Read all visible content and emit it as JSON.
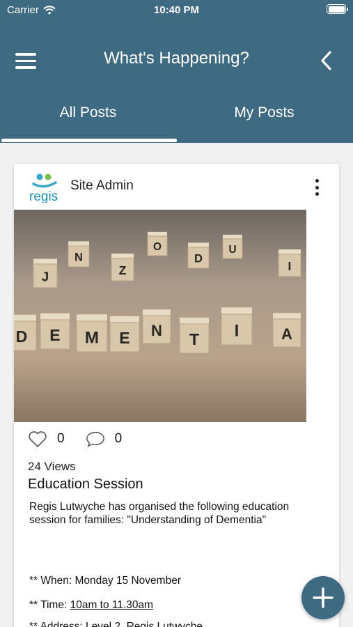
{
  "status_bar": {
    "carrier": "Carrier",
    "time": "10:40 PM"
  },
  "header": {
    "title": "What's Happening?",
    "menu_icon": "hamburger-menu-icon",
    "back_icon": "chevron-left-icon",
    "background": "#3e6a82"
  },
  "tabs": [
    {
      "label": "All Posts",
      "active": true
    },
    {
      "label": "My Posts",
      "active": false
    }
  ],
  "post": {
    "author": "Site Admin",
    "logo_text": "regis",
    "image_letters": {
      "word": [
        "D",
        "E",
        "M",
        "E",
        "N",
        "T",
        "I",
        "A"
      ],
      "background_blocks": [
        "J",
        "N",
        "Z",
        "O",
        "D",
        "U",
        "I"
      ]
    },
    "likes": "0",
    "comments": "0",
    "views": "24 Views",
    "title": "Education Session",
    "body": "Regis Lutwyche has organised the following education session for families: \"Understanding of Dementia\"",
    "when_prefix": "** When: ",
    "when_value": "Monday 15 November",
    "time_prefix": "** Time: ",
    "time_value": "10am to 11.30am",
    "address_partial": "** Address: Level 2, Regis Lutwyche"
  },
  "fab_icon": "plus-icon"
}
